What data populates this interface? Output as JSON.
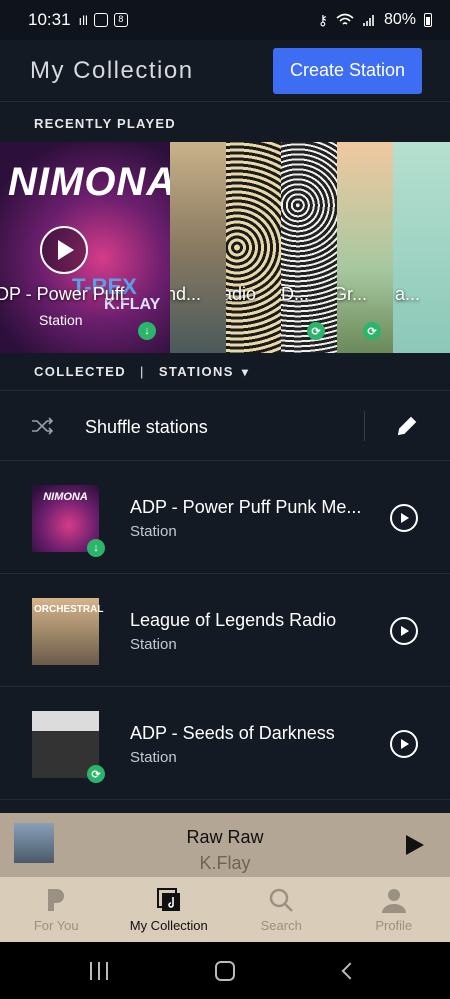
{
  "statusbar": {
    "time": "10:31",
    "battery": "80%",
    "small_badge": "8"
  },
  "header": {
    "title": "My Collection",
    "create_button": "Create Station"
  },
  "recently_played": {
    "label": "RECENTLY PLAYED",
    "tiles": [
      {
        "label": "DP - Power Puff",
        "sub": "Station",
        "art_title": "NIMONA",
        "art_artist_1": "T-REX",
        "art_artist_2": "K.FLAY",
        "badge": "download"
      },
      {
        "label": "nd...",
        "sub": ""
      },
      {
        "label": "adio",
        "sub": ""
      },
      {
        "label": "D...",
        "sub": "",
        "badge": "sync"
      },
      {
        "label": "Gr...",
        "sub": "",
        "badge": "sync"
      },
      {
        "label": "a...",
        "sub": ""
      }
    ]
  },
  "filter": {
    "collected": "COLLECTED",
    "separator": "|",
    "stations": "STATIONS"
  },
  "shuffle": {
    "label": "Shuffle stations"
  },
  "stations": [
    {
      "title": "ADP - Power Puff Punk Me...",
      "sub": "Station",
      "art_text": "NIMONA",
      "badge": "download"
    },
    {
      "title": "League of Legends Radio",
      "sub": "Station",
      "art_text": "ORCHESTRAL"
    },
    {
      "title": "ADP - Seeds of Darkness",
      "sub": "Station",
      "art_text": "",
      "badge": "sync"
    }
  ],
  "now_playing": {
    "title": "Raw Raw",
    "artist": "K.Flay"
  },
  "tabs": [
    {
      "label": "For You",
      "icon": "pandora-p-icon"
    },
    {
      "label": "My Collection",
      "icon": "collection-icon",
      "active": true
    },
    {
      "label": "Search",
      "icon": "search-icon"
    },
    {
      "label": "Profile",
      "icon": "profile-icon"
    }
  ]
}
